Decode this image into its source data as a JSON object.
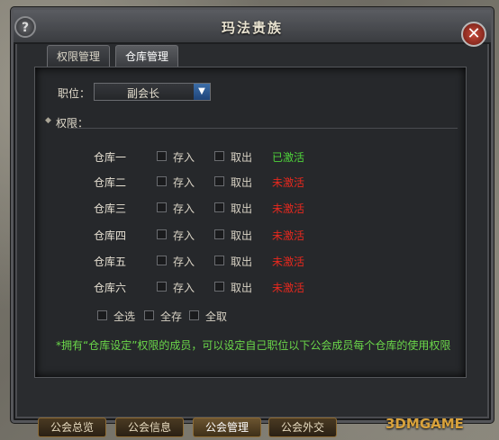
{
  "window": {
    "title": "玛法贵族"
  },
  "tabs": [
    {
      "label": "权限管理"
    },
    {
      "label": "仓库管理"
    }
  ],
  "position": {
    "label": "职位：",
    "selected": "副会长"
  },
  "permissions_label": "权限：",
  "warehouses": [
    {
      "name": "仓库一",
      "store": "存入",
      "take": "取出",
      "status": "已激活"
    },
    {
      "name": "仓库二",
      "store": "存入",
      "take": "取出",
      "status": "未激活"
    },
    {
      "name": "仓库三",
      "store": "存入",
      "take": "取出",
      "status": "未激活"
    },
    {
      "name": "仓库四",
      "store": "存入",
      "take": "取出",
      "status": "未激活"
    },
    {
      "name": "仓库五",
      "store": "存入",
      "take": "取出",
      "status": "未激活"
    },
    {
      "name": "仓库六",
      "store": "存入",
      "take": "取出",
      "status": "未激活"
    }
  ],
  "bulk": {
    "select_all": "全选",
    "store_all": "全存",
    "take_all": "全取"
  },
  "note": "*拥有“仓库设定”权限的成员，可以设定自己职位以下公会成员每个仓库的使用权限",
  "bottom_tabs": [
    {
      "label": "公会总览"
    },
    {
      "label": "公会信息"
    },
    {
      "label": "公会管理"
    },
    {
      "label": "公会外交"
    }
  ],
  "watermark": "3DMGAME",
  "colors": {
    "active": "#4fd43a",
    "inactive": "#e8281e",
    "note": "#6bd84a"
  }
}
